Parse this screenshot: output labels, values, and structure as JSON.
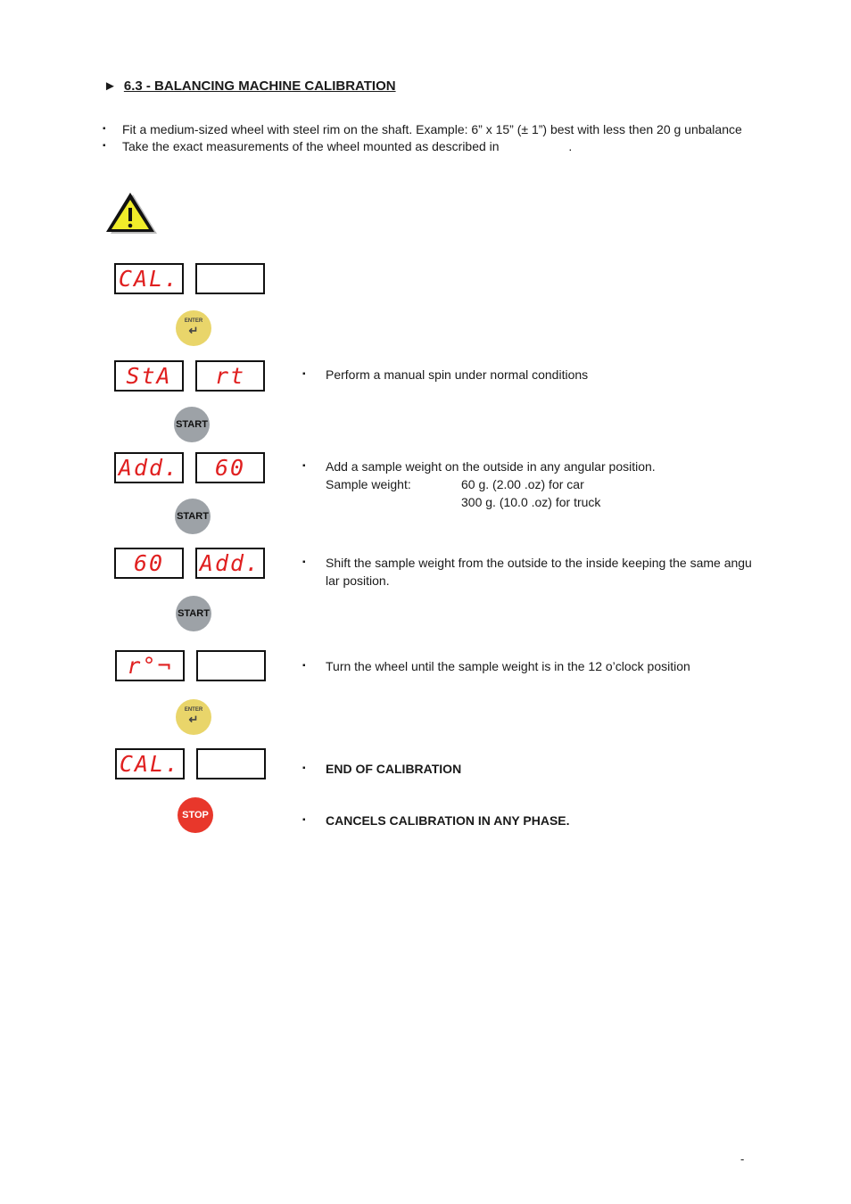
{
  "heading": {
    "marker": "►",
    "title": "6.3 - BALANCING MACHINE CALIBRATION"
  },
  "intro": [
    "Fit a medium-sized wheel with steel rim on the shaft. Example: 6” x 15” (± 1”) best with less then 20 g unbalance",
    "Take the exact measurements of the wheel mounted as described in                    ."
  ],
  "bullet": "▪",
  "steps": [
    {
      "left": "CAL.",
      "right": ""
    },
    {
      "button": "ENTER"
    },
    {
      "left": "StA",
      "right": "rt",
      "text": "Perform a manual spin under normal conditions"
    },
    {
      "button": "START"
    },
    {
      "left": "Add.",
      "right": "60",
      "text": "Add a sample weight on the outside in any angular position.",
      "sample_label": "Sample weight:",
      "sample_car": "60 g. (2.00 .oz) for car",
      "sample_truck": "300 g. (10.0 .oz) for truck"
    },
    {
      "button": "START"
    },
    {
      "left": "60",
      "right": "Add.",
      "text": "Shift the sample weight from the outside to the inside keeping the same angu",
      "text2": "lar position."
    },
    {
      "button": "START"
    },
    {
      "left": "r°¬",
      "right": "",
      "text": "Turn the wheel until the sample weight is in the 12 o’clock position"
    },
    {
      "button": "ENTER"
    },
    {
      "left": "CAL.",
      "right": "",
      "text": "END OF CALIBRATION"
    },
    {
      "button": "STOP",
      "text": "CANCELS CALIBRATION IN ANY PHASE."
    }
  ],
  "page_number": "-",
  "colors": {
    "display_text": "#e02020",
    "enter": "#e9d56a",
    "start": "#9da2a7",
    "stop": "#e8372b"
  }
}
